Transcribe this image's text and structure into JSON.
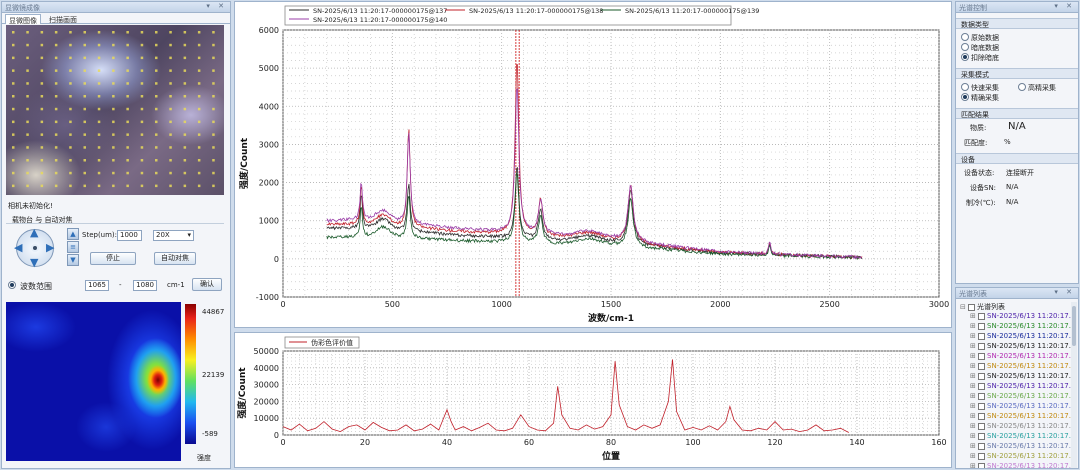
{
  "left": {
    "title": "显微镜成像",
    "title_btns": "▾ ✕",
    "tabs": [
      "显微图像",
      "扫描画面"
    ],
    "camera_status": "相机未初始化!",
    "stage_label": "载物台 与 自动对焦",
    "step_label": "Step(um):",
    "step_value": "1000",
    "objective_value": "20X",
    "stop_btn": "停止",
    "autofocus_btn": "自动对焦",
    "range_label": "波数范围",
    "range_from": "1065",
    "range_sep": "-",
    "range_to": "1080",
    "range_unit": "cm-1",
    "confirm_btn": "确认",
    "colorbar_max": "44867",
    "colorbar_mid": "22139",
    "colorbar_min": "-589",
    "colorbar_name": "强度"
  },
  "colors": {
    "s137": "#2b2b2b",
    "s138": "#c0202a",
    "s139": "#1a5a2a",
    "s140": "#9b3fa8",
    "eval": "#c0202a",
    "cursor": "#d01010"
  },
  "right": {
    "title": "光谱控制",
    "title_btns": "▾ ✕",
    "data_type_header": "数据类型",
    "data_types": [
      "原始数据",
      "暗底数据",
      "扣除暗底"
    ],
    "collect_header": "采集模式",
    "collect_modes": [
      "快速采集",
      "高精采集",
      "精确采集"
    ],
    "match_header": "匹配结果",
    "substance_label": "物质:",
    "substance_value": "N/A",
    "match_rate_label": "匹配度:",
    "match_rate_value": "%",
    "device_header": "设备",
    "device_state_label": "设备状态:",
    "device_state_value": "连接断开",
    "device_sn_label": "设备SN:",
    "device_sn_value": "N/A",
    "cooling_label": "制冷(℃):",
    "cooling_value": "N/A",
    "list_title": "光谱列表",
    "list_root": "光谱列表",
    "list_items": [
      {
        "label": "SN-2025/6/13 11:20:17...",
        "color": "#4b1fa8"
      },
      {
        "label": "SN-2025/6/13 11:20:17...",
        "color": "#2a8a2a"
      },
      {
        "label": "SN-2025/6/13 11:20:17...",
        "color": "#1a2a9a"
      },
      {
        "label": "SN-2025/6/13 11:20:17...",
        "color": "#222222"
      },
      {
        "label": "SN-2025/6/13 11:20:17...",
        "color": "#b02ab0"
      },
      {
        "label": "SN-2025/6/13 11:20:17...",
        "color": "#c08a10"
      },
      {
        "label": "SN-2025/6/13 11:20:17...",
        "color": "#222222"
      },
      {
        "label": "SN-2025/6/13 11:20:17...",
        "color": "#4b1fa8"
      },
      {
        "label": "SN-2025/6/13 11:20:17...",
        "color": "#6aa84a"
      },
      {
        "label": "SN-2025/6/13 11:20:17...",
        "color": "#5a6ac0"
      },
      {
        "label": "SN-2025/6/13 11:20:17...",
        "color": "#c08a10"
      },
      {
        "label": "SN-2025/6/13 11:20:17...",
        "color": "#888888"
      },
      {
        "label": "SN-2025/6/13 11:20:17...",
        "color": "#2aa0a0"
      },
      {
        "label": "SN-2025/6/13 11:20:17...",
        "color": "#6a7aaa"
      },
      {
        "label": "SN-2025/6/13 11:20:17...",
        "color": "#a0a040"
      },
      {
        "label": "SN-2025/6/13 11:20:17...",
        "color": "#c07ad0"
      },
      {
        "label": "SN-2025/6/13 11:20:17...",
        "color": "#c09a20"
      }
    ]
  },
  "chart_data": [
    {
      "type": "line",
      "xlabel": "波数/cm-1",
      "ylabel": "强度/Count",
      "xlim": [
        0,
        3000
      ],
      "ylim": [
        -1000,
        6000
      ],
      "xticks": [
        0,
        500,
        1000,
        1500,
        2000,
        2500,
        3000
      ],
      "yticks": [
        -1000,
        0,
        1000,
        2000,
        3000,
        4000,
        5000,
        6000
      ],
      "legend": [
        "SN-2025/6/13 11:20:17-000000175@137",
        "SN-2025/6/13 11:20:17-000000175@138",
        "SN-2025/6/13 11:20:17-000000175@139",
        "SN-2025/6/13 11:20:17-000000175@140"
      ],
      "cursor_x": [
        1065,
        1080
      ],
      "series": [
        {
          "name": "SN-2025/6/13 11:20:17-000000175@137",
          "color_key": "s137",
          "baseline": [
            [
              200,
              800
            ],
            [
              400,
              820
            ],
            [
              550,
              740
            ],
            [
              800,
              620
            ],
            [
              1000,
              560
            ],
            [
              1200,
              500
            ],
            [
              1450,
              440
            ],
            [
              1550,
              420
            ],
            [
              1700,
              320
            ],
            [
              2000,
              160
            ],
            [
              2300,
              100
            ],
            [
              2650,
              40
            ]
          ],
          "peaks": [
            [
              358,
              900
            ],
            [
              575,
              1250
            ],
            [
              1070,
              1900
            ],
            [
              1178,
              780
            ],
            [
              1590,
              1400
            ],
            [
              2225,
              280
            ]
          ]
        },
        {
          "name": "SN-2025/6/13 11:20:17-000000175@138",
          "color_key": "s138",
          "baseline": [
            [
              200,
              900
            ],
            [
              400,
              920
            ],
            [
              550,
              840
            ],
            [
              800,
              720
            ],
            [
              1000,
              660
            ],
            [
              1200,
              600
            ],
            [
              1450,
              520
            ],
            [
              1550,
              480
            ],
            [
              1700,
              350
            ],
            [
              2000,
              170
            ],
            [
              2300,
              100
            ],
            [
              2650,
              40
            ]
          ],
          "peaks": [
            [
              358,
              1050
            ],
            [
              575,
              2600
            ],
            [
              1070,
              4650
            ],
            [
              1178,
              950
            ],
            [
              1590,
              1500
            ],
            [
              2225,
              320
            ]
          ]
        },
        {
          "name": "SN-2025/6/13 11:20:17-000000175@139",
          "color_key": "s139",
          "baseline": [
            [
              200,
              560
            ],
            [
              400,
              600
            ],
            [
              550,
              560
            ],
            [
              800,
              480
            ],
            [
              1000,
              440
            ],
            [
              1200,
              400
            ],
            [
              1450,
              360
            ],
            [
              1550,
              340
            ],
            [
              1700,
              260
            ],
            [
              2000,
              130
            ],
            [
              2300,
              80
            ],
            [
              2650,
              30
            ]
          ],
          "peaks": [
            [
              358,
              800
            ],
            [
              575,
              1150
            ],
            [
              1070,
              1850
            ],
            [
              1178,
              700
            ],
            [
              1590,
              1250
            ],
            [
              2225,
              260
            ]
          ]
        },
        {
          "name": "SN-2025/6/13 11:20:17-000000175@140",
          "color_key": "s140",
          "baseline": [
            [
              200,
              1000
            ],
            [
              400,
              1050
            ],
            [
              550,
              950
            ],
            [
              800,
              800
            ],
            [
              1000,
              720
            ],
            [
              1200,
              650
            ],
            [
              1450,
              560
            ],
            [
              1550,
              520
            ],
            [
              1700,
              380
            ],
            [
              2000,
              190
            ],
            [
              2300,
              110
            ],
            [
              2650,
              40
            ]
          ],
          "peaks": [
            [
              358,
              1000
            ],
            [
              575,
              2400
            ],
            [
              1070,
              3900
            ],
            [
              1178,
              900
            ],
            [
              1590,
              1480
            ],
            [
              2225,
              320
            ]
          ]
        }
      ]
    },
    {
      "type": "line",
      "xlabel": "位置",
      "ylabel": "强度/Count",
      "xlim": [
        0,
        160
      ],
      "ylim": [
        0,
        50000
      ],
      "xticks": [
        0,
        20,
        40,
        60,
        80,
        100,
        120,
        140,
        160
      ],
      "yticks": [
        0,
        10000,
        20000,
        30000,
        40000,
        50000
      ],
      "legend": [
        "伪彩色评价值"
      ],
      "series": [
        {
          "name": "伪彩色评价值",
          "color_key": "eval",
          "x": [
            0,
            2,
            4,
            6,
            8,
            10,
            12,
            14,
            16,
            18,
            20,
            22,
            24,
            26,
            28,
            30,
            32,
            34,
            36,
            38,
            39,
            40,
            41,
            42,
            44,
            46,
            48,
            50,
            52,
            54,
            56,
            58,
            60,
            62,
            64,
            66,
            67,
            68,
            70,
            72,
            74,
            76,
            78,
            80,
            81,
            82,
            84,
            86,
            88,
            90,
            92,
            94,
            95,
            96,
            98,
            100,
            102,
            104,
            106,
            108,
            109,
            110,
            112,
            114,
            116,
            118,
            120,
            122,
            124,
            126,
            128,
            130,
            132,
            134,
            136,
            138
          ],
          "y": [
            5000,
            3000,
            6500,
            2500,
            4000,
            8000,
            3500,
            2000,
            5000,
            6000,
            3000,
            7500,
            4500,
            2500,
            3000,
            6000,
            2500,
            3500,
            6500,
            3000,
            9000,
            15000,
            8000,
            3000,
            5000,
            2500,
            4500,
            7000,
            3000,
            2500,
            4000,
            12000,
            5000,
            3000,
            2500,
            7000,
            29000,
            12000,
            4000,
            3000,
            6000,
            3500,
            5000,
            12000,
            44000,
            18000,
            5000,
            3000,
            6000,
            4000,
            6000,
            20000,
            45000,
            14000,
            3000,
            4500,
            3000,
            5500,
            3000,
            8000,
            17000,
            9000,
            3000,
            2500,
            4000,
            3000,
            8000,
            3000,
            3500,
            2000,
            3000,
            6000,
            2500,
            3000,
            4000,
            1500
          ]
        }
      ]
    }
  ]
}
